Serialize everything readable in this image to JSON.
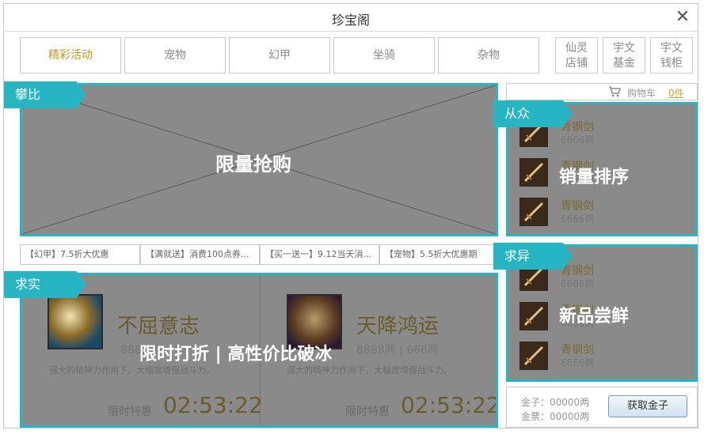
{
  "window": {
    "title": "珍宝阁"
  },
  "tabs": [
    {
      "label": "精彩活动",
      "active": true
    },
    {
      "label": "宠物",
      "active": false
    },
    {
      "label": "幻甲",
      "active": false
    },
    {
      "label": "坐骑",
      "active": false
    },
    {
      "label": "杂物",
      "active": false
    }
  ],
  "side_tabs": [
    {
      "line1": "仙灵",
      "line2": "店铺"
    },
    {
      "line1": "宇文",
      "line2": "基金"
    },
    {
      "line1": "宇文",
      "line2": "钱柜"
    }
  ],
  "banner": {
    "ribbon": "攀比",
    "overlay": "限量抢购"
  },
  "promos": [
    "【幻甲】7.5折大优惠",
    "【满就送】消费100点券...",
    "【买一送一】9.12当天消...",
    "【宠物】5.5折大优惠期"
  ],
  "deals": {
    "ribbon": "求实",
    "overlay": "限时打折 | 高性价比破冰",
    "items": [
      {
        "name": "不屈意志",
        "price": "8888两",
        "desc": "强大的精神力作用下，大幅度增强战斗力。",
        "label": "限时特惠",
        "timer": "02:53:22"
      },
      {
        "name": "天降鸿运",
        "price": "8888两 | 666两",
        "desc": "强大的精神力作用下，大幅度增强战斗力。",
        "label": "限时特惠",
        "timer": "02:53:22"
      }
    ]
  },
  "cart": {
    "label": "购物车",
    "count": "0件"
  },
  "top_sales": {
    "ribbon": "从众",
    "overlay": "销量排序",
    "items": [
      {
        "name": "青钢剑",
        "price": "6666两"
      },
      {
        "name": "青钢剑",
        "price": "6666两"
      },
      {
        "name": "青钢剑",
        "price": "6666两"
      }
    ]
  },
  "new_items": {
    "ribbon": "求异",
    "overlay": "新品尝鲜",
    "items": [
      {
        "name": "青钢剑",
        "price": "6666两"
      },
      {
        "name": "青钢剑",
        "price": "6666两"
      },
      {
        "name": "青钢剑",
        "price": "6666两"
      }
    ]
  },
  "currency": {
    "gold": "金子：00000两",
    "ticket": "金票：00000两",
    "button": "获取金子"
  },
  "colors": {
    "accent": "#26b5c2",
    "gold_text": "#c6951f",
    "panel_bg": "#8a8a8a"
  }
}
